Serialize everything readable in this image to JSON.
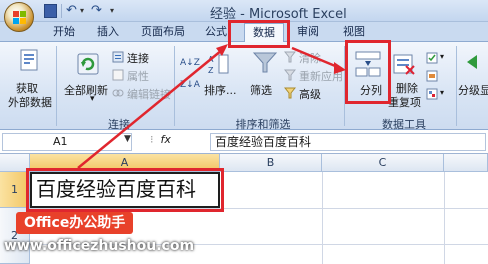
{
  "window": {
    "title": "经验 - Microsoft Excel"
  },
  "quick_access": {
    "undo_icon": "undo-icon",
    "redo_icon": "redo-icon",
    "save_icon": "save-icon"
  },
  "tabs": [
    {
      "label": "开始"
    },
    {
      "label": "插入"
    },
    {
      "label": "页面布局"
    },
    {
      "label": "公式"
    },
    {
      "label": "数据",
      "active": true
    },
    {
      "label": "审阅"
    },
    {
      "label": "视图"
    }
  ],
  "ribbon": {
    "get_external": {
      "line1": "获取",
      "line2": "外部数据"
    },
    "refresh_all": "全部刷新",
    "connections": "连接",
    "properties": "属性",
    "edit_links": "编辑链接",
    "group_connections": "连接",
    "sort_az": "A↓Z",
    "sort_za": "Z↓A",
    "sort": "排序...",
    "filter": "筛选",
    "clear": "清除",
    "reapply": "重新应用",
    "advanced": "高级",
    "group_sort_filter": "排序和筛选",
    "text_to_columns": "分列",
    "remove_duplicates_1": "删除",
    "remove_duplicates_2": "重复项",
    "group_data_tools": "数据工具",
    "outline_label": "分级显"
  },
  "formula_bar": {
    "name_box": "A1",
    "fx": "fx",
    "content": "百度经验百度百科"
  },
  "sheet": {
    "columns": [
      "A",
      "B",
      "C"
    ],
    "rows": [
      "1",
      "2"
    ],
    "a1_value": "百度经验百度百科"
  },
  "watermark": {
    "badge": "Office办公助手",
    "url": "www.officezhushou.com"
  },
  "colors": {
    "highlight": "#e0262e",
    "ribbon_bg": "#d8e4f4"
  }
}
